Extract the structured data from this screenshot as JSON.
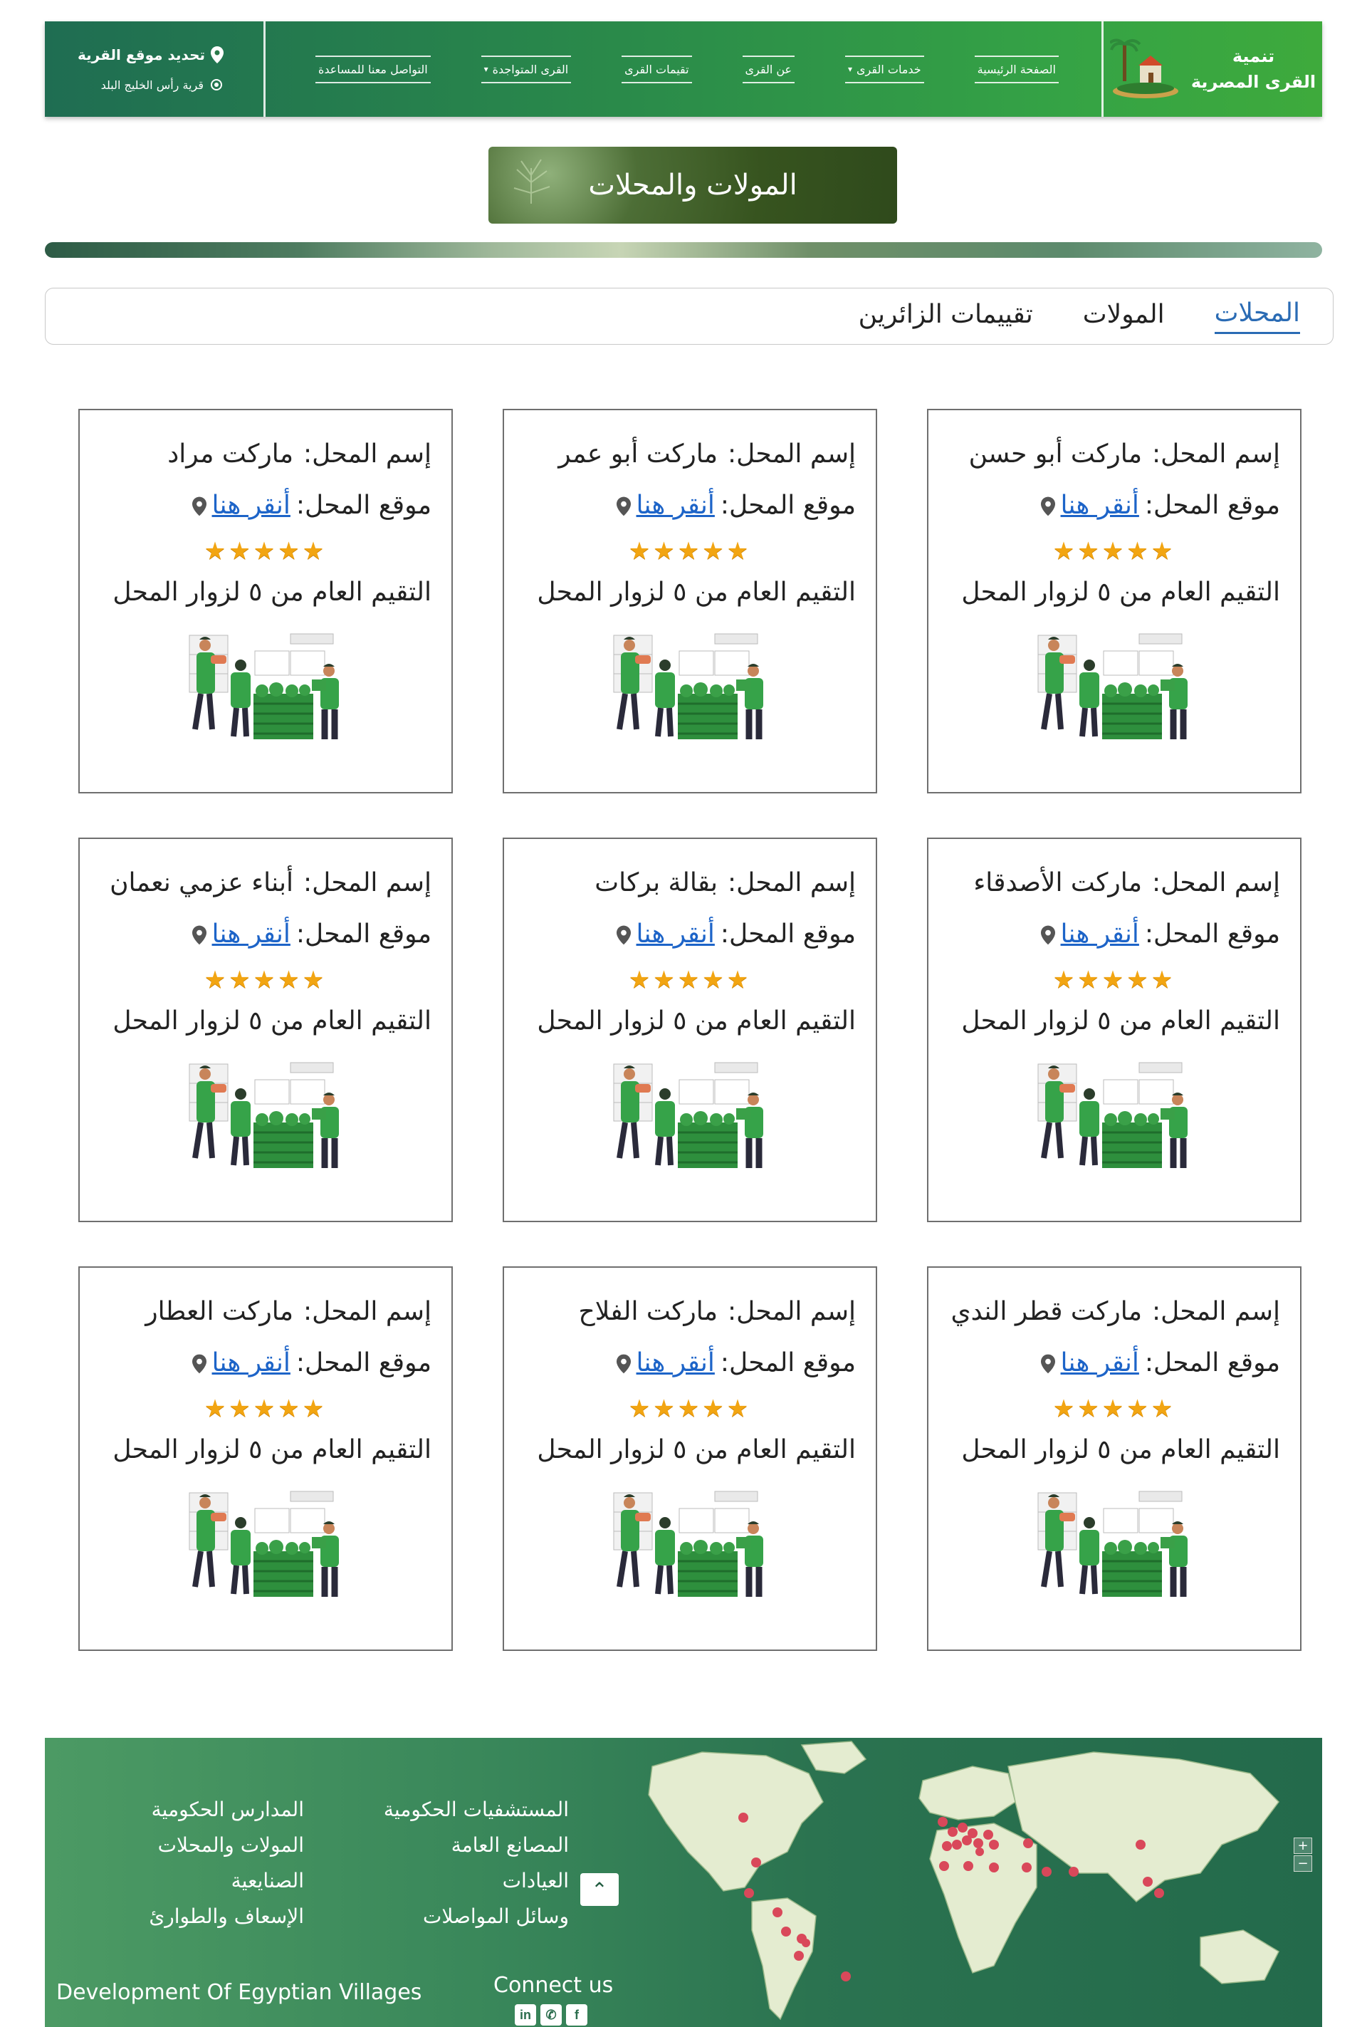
{
  "header": {
    "brand_line1": "تنمية",
    "brand_line2": "القرى المصرية",
    "nav": [
      {
        "label": "الصفحة الرئيسية",
        "has_dropdown": false
      },
      {
        "label": "خدمات القرى",
        "has_dropdown": true
      },
      {
        "label": "عن القرى",
        "has_dropdown": false
      },
      {
        "label": "تقيمات القرى",
        "has_dropdown": false
      },
      {
        "label": "القرى المتواجدة",
        "has_dropdown": true
      },
      {
        "label": "التواصل معنا للمساعدة",
        "has_dropdown": false
      }
    ],
    "location_action": "تحديد موقع القرية",
    "current_village": "قرية رأس الخليج البلد"
  },
  "page": {
    "title": "المولات والمحلات"
  },
  "tabs": [
    {
      "label": "المحلات",
      "active": true
    },
    {
      "label": "المولات",
      "active": false
    },
    {
      "label": "تقييمات الزائرين",
      "active": false
    }
  ],
  "card_labels": {
    "name_label": "إسم المحل:",
    "location_label": "موقع المحل:",
    "location_link": "أنقر هنا",
    "rating_text": "التقيم العام من ٥ لزوار المحل"
  },
  "shops": [
    {
      "name": "ماركت أبو حسن",
      "rating": 5
    },
    {
      "name": "ماركت أبو عمر",
      "rating": 5
    },
    {
      "name": "ماركت مراد",
      "rating": 5
    },
    {
      "name": "ماركت الأصدقاء",
      "rating": 5
    },
    {
      "name": "بقالة بركات",
      "rating": 5
    },
    {
      "name": "أبناء عزمي نعمان",
      "rating": 5
    },
    {
      "name": "ماركت قطر الندي",
      "rating": 5
    },
    {
      "name": "ماركت الفلاح",
      "rating": 5
    },
    {
      "name": "ماركت العطار",
      "rating": 5
    }
  ],
  "footer": {
    "links_col_a": [
      "المستشفيات الحكومية",
      "المصانع العامة",
      "العيادات",
      "وسائل المواصلات"
    ],
    "links_col_b": [
      "المدارس الحكومية",
      "المولات والمحلات",
      "الصنايعية",
      "الإسعاف والطوارئ"
    ],
    "brand_en": "Development Of Egyptian Villages",
    "connect": "Connect us",
    "socials": [
      "linkedin-icon",
      "whatsapp-icon",
      "facebook-icon"
    ],
    "zoom_in": "+",
    "zoom_out": "−"
  },
  "colors": {
    "header_green": "#2a8a4a",
    "footer_green": "#2b7350",
    "link_blue": "#1d64c8",
    "tab_active": "#2a6bb4",
    "star": "#f2a512"
  }
}
